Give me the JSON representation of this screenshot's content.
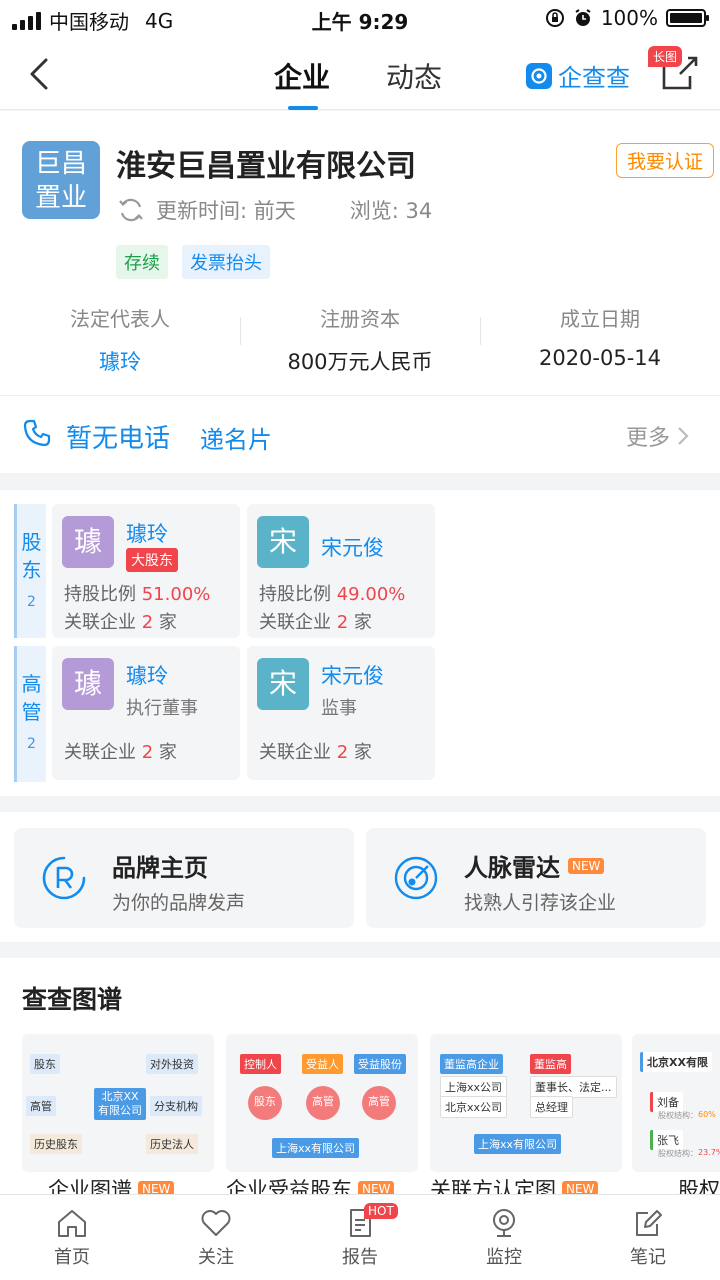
{
  "status_bar": {
    "carrier": "中国移动",
    "network": "4G",
    "time": "上午 9:29",
    "battery": "100%"
  },
  "nav": {
    "tabs": [
      {
        "label": "企业"
      },
      {
        "label": "动态"
      }
    ],
    "brand": "企查查",
    "share_badge": "长图"
  },
  "company": {
    "logo_line1": "巨昌",
    "logo_line2": "置业",
    "name": "淮安巨昌置业有限公司",
    "claim": "我要认证",
    "update": "更新时间: 前天",
    "views": "浏览: 34",
    "tags": [
      "存续",
      "发票抬头"
    ],
    "info": [
      {
        "label": "法定代表人",
        "value": "璩玲"
      },
      {
        "label": "注册资本",
        "value": "800万元人民币"
      },
      {
        "label": "成立日期",
        "value": "2020-05-14"
      }
    ]
  },
  "contact": {
    "phone": "暂无电话",
    "card": "递名片",
    "more": "更多"
  },
  "people": {
    "shareholders": {
      "label": "股东",
      "count": "2",
      "items": [
        {
          "avatar": "璩",
          "name": "璩玲",
          "badge": "大股东",
          "ratio_label": "持股比例",
          "ratio": "51.00%",
          "rel_label": "关联企业",
          "rel_count": "2",
          "rel_unit": "家"
        },
        {
          "avatar": "宋",
          "name": "宋元俊",
          "ratio_label": "持股比例",
          "ratio": "49.00%",
          "rel_label": "关联企业",
          "rel_count": "2",
          "rel_unit": "家"
        }
      ]
    },
    "executives": {
      "label": "高管",
      "count": "2",
      "items": [
        {
          "avatar": "璩",
          "name": "璩玲",
          "role": "执行董事",
          "rel_label": "关联企业",
          "rel_count": "2",
          "rel_unit": "家"
        },
        {
          "avatar": "宋",
          "name": "宋元俊",
          "role": "监事",
          "rel_label": "关联企业",
          "rel_count": "2",
          "rel_unit": "家"
        }
      ]
    }
  },
  "features": [
    {
      "title": "品牌主页",
      "sub": "为你的品牌发声"
    },
    {
      "title": "人脉雷达",
      "badge": "NEW",
      "sub": "找熟人引荐该企业"
    }
  ],
  "graphs": {
    "title": "查查图谱",
    "cards": [
      {
        "caption": "企业图谱",
        "badge": "NEW",
        "nodes": [
          "股东",
          "对外投资",
          "高管",
          "北京XX有限公司",
          "分支机构",
          "历史股东",
          "历史法人"
        ]
      },
      {
        "caption": "企业受益股东",
        "badge": "NEW",
        "nodes": [
          "控制人",
          "受益人",
          "受益股份",
          "股东",
          "高管",
          "高管",
          "上海xx有限公司"
        ]
      },
      {
        "caption": "关联方认定图",
        "badge": "NEW",
        "nodes": [
          "董监高企业",
          "董监高",
          "上海xx公司",
          "董事长、法定...",
          "北京xx公司",
          "总经理",
          "上海xx有限公司"
        ]
      },
      {
        "caption": "股权",
        "nodes": [
          "北京XX有限",
          "刘备",
          "股权结构：",
          "60%",
          "张飞",
          "股权结构：",
          "23.7%"
        ]
      }
    ]
  },
  "tabbar": [
    {
      "label": "首页"
    },
    {
      "label": "关注"
    },
    {
      "label": "报告",
      "badge": "HOT"
    },
    {
      "label": "监控"
    },
    {
      "label": "笔记"
    }
  ],
  "colors": {
    "primary": "#128bed",
    "danger": "#f0454b",
    "warning": "#ff8a00"
  }
}
